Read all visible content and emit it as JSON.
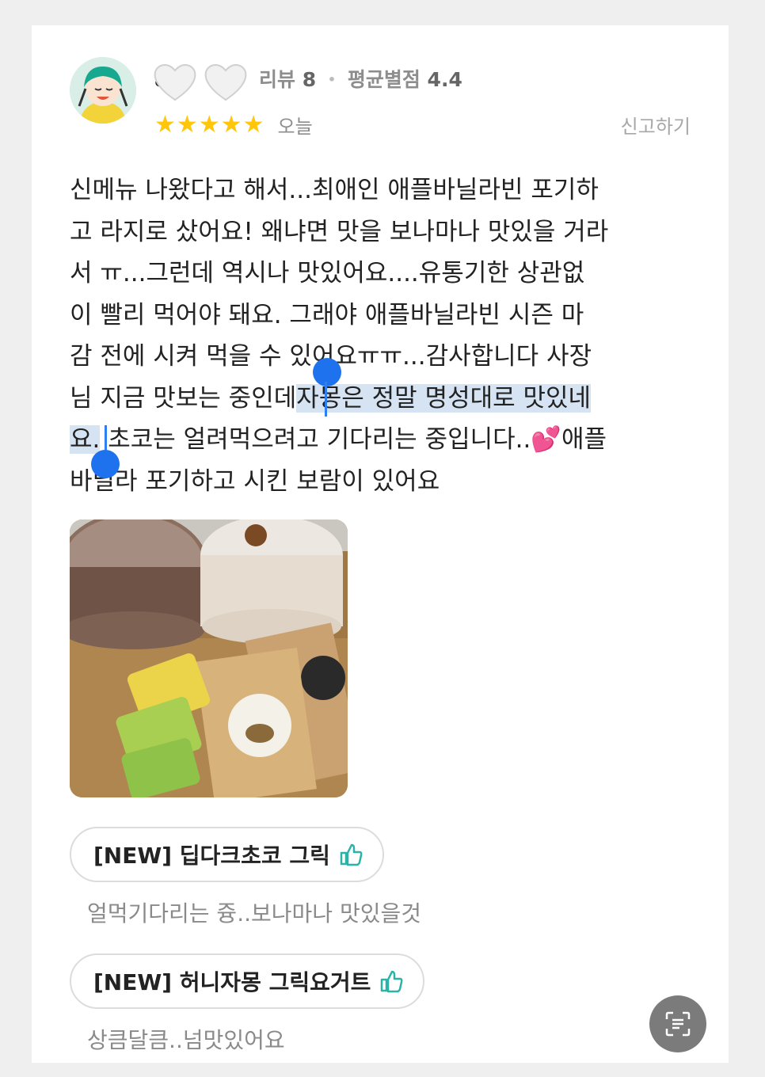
{
  "review": {
    "author_name": "a   c",
    "meta": {
      "review_label": "리뷰",
      "review_count": "8",
      "separator": "•",
      "avg_label": "평균별점",
      "avg_value": "4.4"
    },
    "rating": 5,
    "stars": "★★★★★",
    "date": "오늘",
    "report_label": "신고하기",
    "text": {
      "line1": "신메뉴 나왔다고 해서...최애인 애플바닐라빈 포기하",
      "line2": "고 라지로 샀어요! 왜냐면 맛을 보나마나 맛있을 거라",
      "line3": "서 ㅠ...그런데 역시나 맛있어요....유통기한 상관없",
      "line4": "이 빨리 먹어야 돼요. 그래야 애플바닐라빈 시즌 마",
      "line5": "감 전에 시켜 먹을 수 있어요ㅠㅠ...감사합니다 사장",
      "line6_before": "님 지금 맛보는 중인데",
      "line6_selected": "자몽은 정말 명성대로 맛있네",
      "line7_selected": "요.",
      "line7_after": "초코는 얼려먹으려고 기다리는 중입니다..",
      "line7_emoji": "💕",
      "line7_end": "애플",
      "line8": "바닐라 포기하고 시킨 보람이 있어요"
    }
  },
  "menu_items": [
    {
      "name": "[NEW] 딥다크초코 그릭",
      "comment": "얼먹기다리는 즁..보나마나 맛있을것",
      "liked": true
    },
    {
      "name": "[NEW] 허니자몽 그릭요거트",
      "comment": "상큼달큼..넘맛있어요",
      "liked": true
    }
  ],
  "icons": {
    "thumb": "thumbs-up-icon",
    "scan": "text-scan-icon",
    "heart_sticker": "heart-icon"
  },
  "colors": {
    "star": "#ffc60a",
    "selection": "#d5e3f3",
    "handle": "#1f72ee",
    "thumb": "#2bb3a7"
  }
}
